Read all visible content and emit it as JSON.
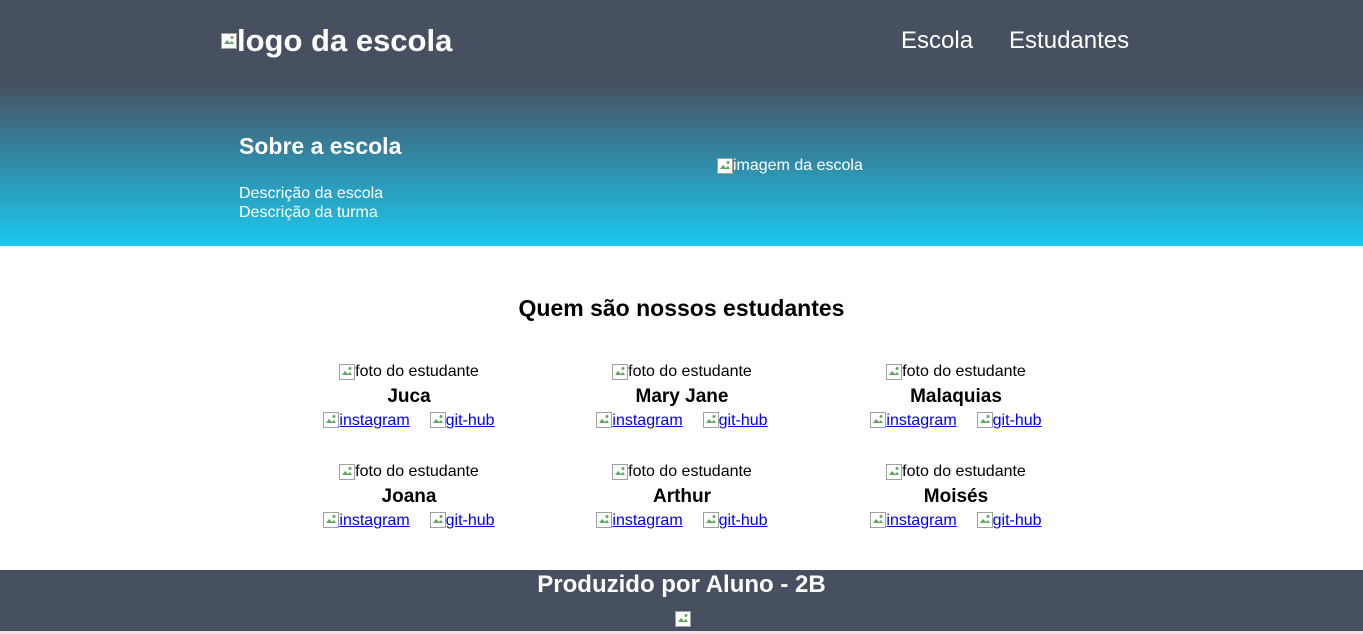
{
  "header": {
    "logo_alt": "logo da escola",
    "nav": [
      {
        "label": "Escola"
      },
      {
        "label": "Estudantes"
      }
    ],
    "about_title": "Sobre a escola",
    "school_description": "Descrição da escola",
    "class_description": "Descrição da turma",
    "school_image_alt": "imagem da escola"
  },
  "students": {
    "title": "Quem são nossos estudantes",
    "photo_alt": "foto do estudante",
    "instagram_alt": "instagram",
    "github_alt": "git-hub",
    "items": [
      {
        "name": "Juca"
      },
      {
        "name": "Mary Jane"
      },
      {
        "name": "Malaquias"
      },
      {
        "name": "Joana"
      },
      {
        "name": "Arthur"
      },
      {
        "name": "Moisés"
      }
    ]
  },
  "footer": {
    "text": "Produzido por Aluno - 2B"
  },
  "colors": {
    "header_dark": "#475061",
    "header_light": "#1bc8f0",
    "link": "#0000ee"
  },
  "icons": {
    "broken_image": "broken-image-icon"
  }
}
